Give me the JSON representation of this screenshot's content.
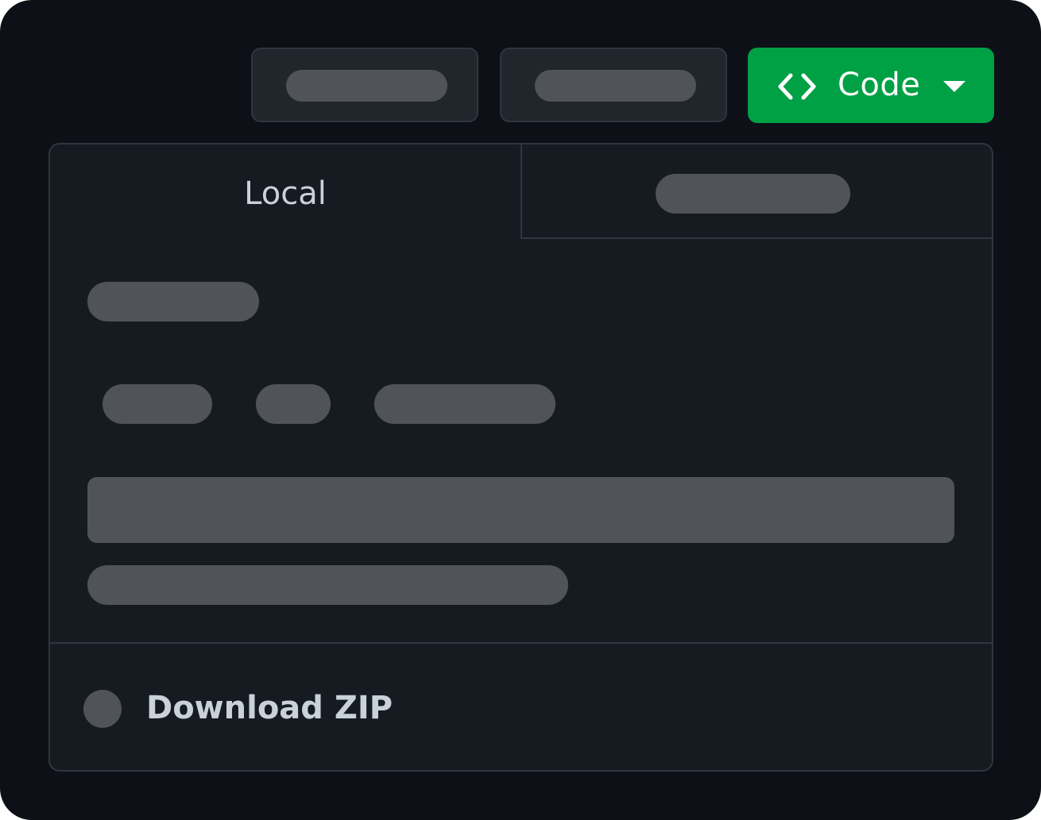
{
  "toolbar": {
    "code_button": {
      "label": "Code",
      "icon": "code-brackets-icon",
      "dropdown_icon": "caret-down-icon",
      "color": "#00a044"
    }
  },
  "panel": {
    "tabs": [
      {
        "label": "Local",
        "active": true
      }
    ],
    "footer": {
      "download_label": "Download ZIP"
    }
  },
  "colors": {
    "background": "#0d1117",
    "panel": "#161b22",
    "border": "#30363d",
    "placeholder": "#505459",
    "text": "#c9d1d9"
  }
}
